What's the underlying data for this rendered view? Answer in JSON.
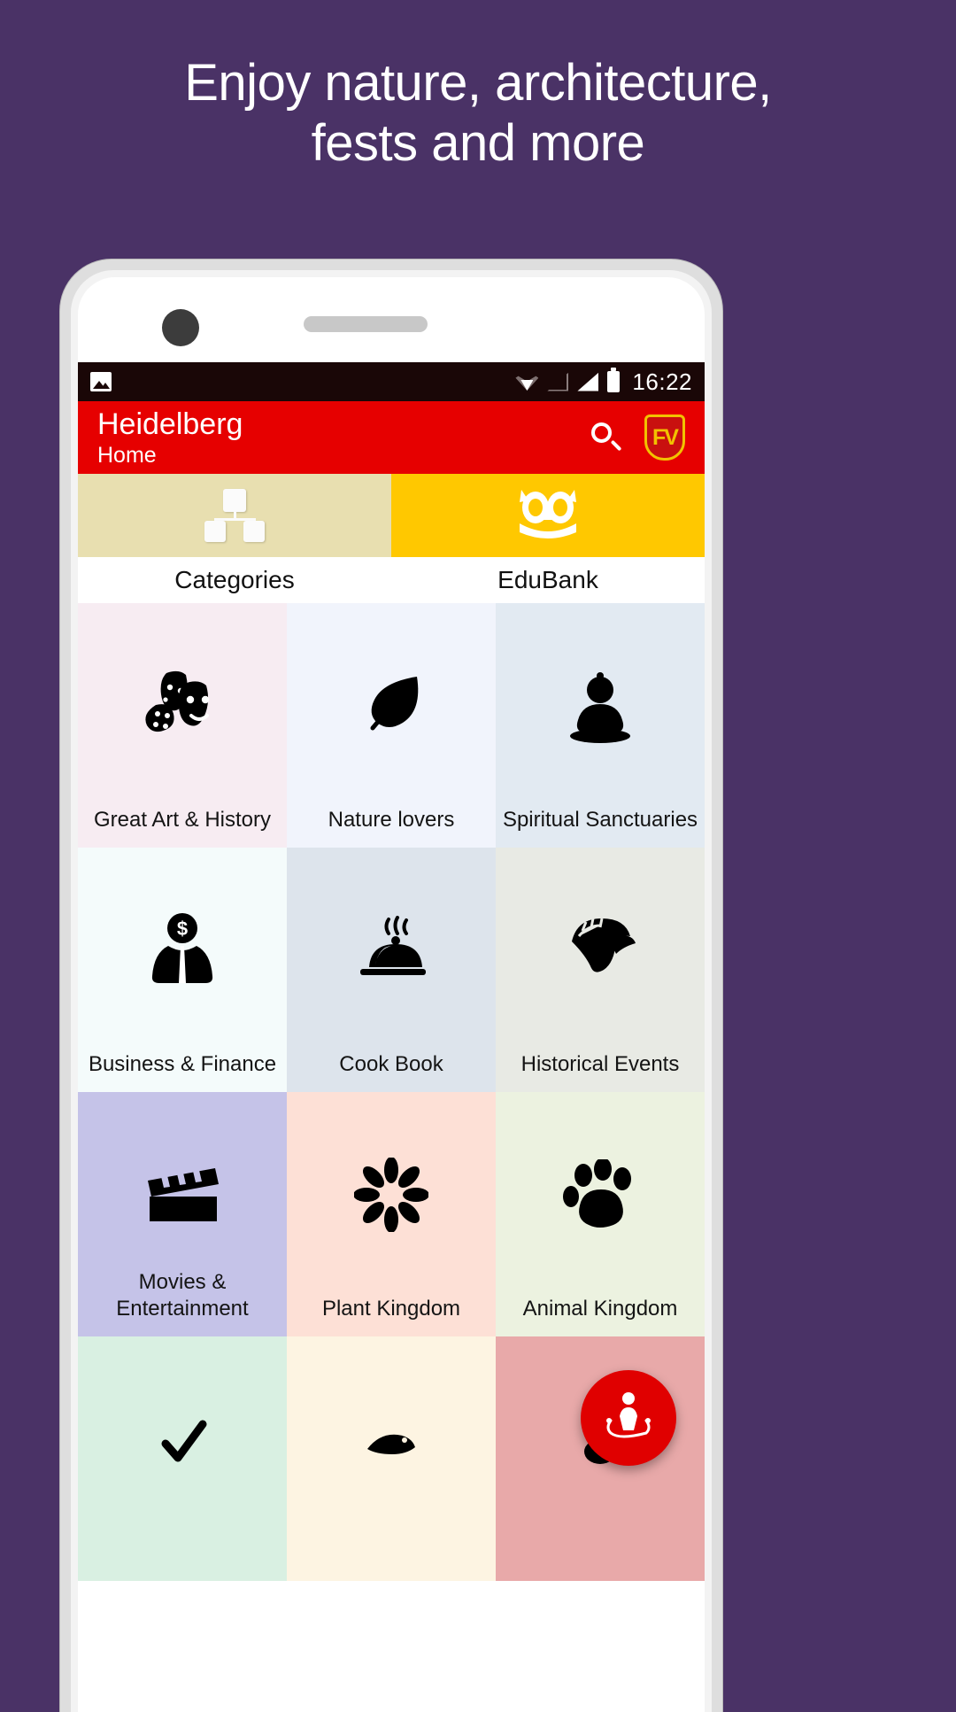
{
  "promo": {
    "line1": "Enjoy nature, architecture,",
    "line2": "fests and more"
  },
  "statusbar": {
    "photo_icon": "photo-icon",
    "wifi_icon": "wifi-icon",
    "signal_icon_1": "signal-empty-icon",
    "signal_icon_2": "signal-full-icon",
    "battery_icon": "battery-full-icon",
    "time": "16:22"
  },
  "appbar": {
    "title": "Heidelberg",
    "subtitle": "Home",
    "search_icon": "search-icon",
    "brand_label": "FV",
    "brand_icon": "shield-logo-icon",
    "background": "#e60000"
  },
  "tabs": [
    {
      "label": "Categories",
      "icon": "sitemap-icon",
      "background": "#e8dfb0",
      "active": false
    },
    {
      "label": "EduBank",
      "icon": "owl-icon",
      "background": "#ffc800",
      "active": true
    }
  ],
  "grid": {
    "tiles": [
      {
        "label": "Great Art & History",
        "icon": "theater-masks-palette-icon",
        "background": "#f7ecf2"
      },
      {
        "label": "Nature lovers",
        "icon": "leaf-icon",
        "background": "#f1f4fc"
      },
      {
        "label": "Spiritual Sanctuaries",
        "icon": "buddha-icon",
        "background": "#e2eaf2"
      },
      {
        "label": "Business & Finance",
        "icon": "businessman-dollar-icon",
        "background": "#f4fbfb"
      },
      {
        "label": "Cook Book",
        "icon": "food-cloche-icon",
        "background": "#dde4ec"
      },
      {
        "label": "Historical Events",
        "icon": "spartan-helmet-icon",
        "background": "#e8eae4"
      },
      {
        "label": "Movies & Entertainment",
        "icon": "clapperboard-icon",
        "background": "#c5c3e8"
      },
      {
        "label": "Plant Kingdom",
        "icon": "flower-icon",
        "background": "#fde0d6"
      },
      {
        "label": "Animal Kingdom",
        "icon": "paw-print-icon",
        "background": "#ecf2e0"
      },
      {
        "label": "",
        "icon": "check-icon",
        "background": "#d9f0e2"
      },
      {
        "label": "",
        "icon": "partial-icon",
        "background": "#fdf4e2"
      },
      {
        "label": "",
        "icon": "partial-icon-2",
        "background": "#e8a9a9"
      }
    ]
  },
  "fab": {
    "icon": "person-location-icon",
    "background": "#e00000"
  }
}
